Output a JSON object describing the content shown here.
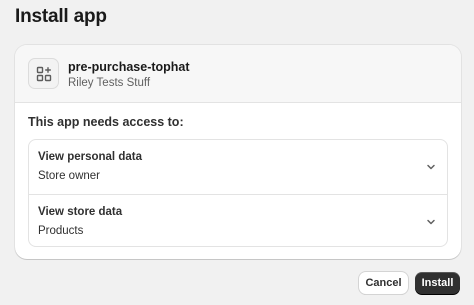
{
  "page": {
    "title": "Install app"
  },
  "app": {
    "icon": "app-grid-plus-icon",
    "name": "pre-purchase-tophat",
    "developer": "Riley Tests Stuff"
  },
  "access": {
    "heading": "This app needs access to:",
    "permissions": [
      {
        "title": "View personal data",
        "detail": "Store owner",
        "icon": "chevron-down-icon"
      },
      {
        "title": "View store data",
        "detail": "Products",
        "icon": "chevron-down-icon"
      }
    ]
  },
  "actions": {
    "cancel_label": "Cancel",
    "install_label": "Install"
  },
  "colors": {
    "primary_button": "#303030",
    "page_background": "#f1f1f1",
    "card_background": "#ffffff"
  }
}
